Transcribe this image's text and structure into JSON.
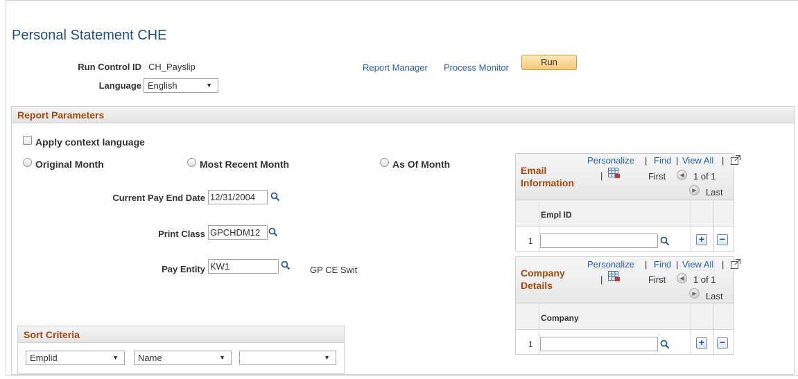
{
  "page": {
    "title": "Personal Statement CHE"
  },
  "header": {
    "run_control_label": "Run Control ID",
    "run_control_value": "CH_Payslip",
    "language_label": "Language",
    "language_value": "English",
    "report_manager": "Report Manager",
    "process_monitor": "Process Monitor",
    "run_label": "Run"
  },
  "report_parameters": {
    "title": "Report Parameters",
    "apply_context_language": "Apply context language",
    "radio_original": "Original Month",
    "radio_recent": "Most Recent Month",
    "radio_asof": "As Of Month",
    "current_pay_end_label": "Current Pay End Date",
    "current_pay_end_value": "12/31/2004",
    "print_class_label": "Print Class",
    "print_class_value": "GPCHDM12",
    "pay_entity_label": "Pay Entity",
    "pay_entity_value": "KW1",
    "pay_entity_desc": "GP CE Swit"
  },
  "email_grid": {
    "title_line1": "Email",
    "title_line2": "Information",
    "personalize": "Personalize",
    "find": "Find",
    "view_all": "View All",
    "sep": "|",
    "first": "First",
    "range": "1 of 1",
    "last": "Last",
    "column": "Empl ID",
    "row_num": "1",
    "plus": "+",
    "minus": "−"
  },
  "company_grid": {
    "title_line1": "Company",
    "title_line2": "Details",
    "personalize": "Personalize",
    "find": "Find",
    "view_all": "View All",
    "sep": "|",
    "first": "First",
    "range": "1 of 1",
    "last": "Last",
    "column": "Company",
    "row_num": "1",
    "plus": "+",
    "minus": "−"
  },
  "sort_criteria": {
    "title": "Sort Criteria",
    "select1": "Emplid",
    "select2": "Name",
    "select3": ""
  },
  "icons": {
    "lookup": "magnifier-icon",
    "grid_download": "grid-download-icon",
    "zoom": "expand-grid-icon",
    "prev": "previous-arrow-icon",
    "next": "next-arrow-icon",
    "dropdown": "dropdown-arrow-icon"
  },
  "colors": {
    "title": "#1f4e79",
    "section_header": "#a04a12",
    "link": "#2862a5",
    "run_button": "#f7c97a"
  }
}
